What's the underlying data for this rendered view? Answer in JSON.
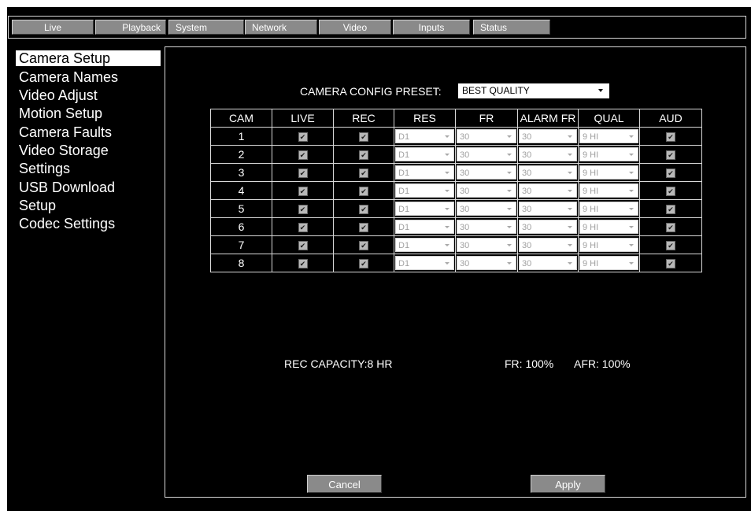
{
  "nav": {
    "tabs": [
      "Live",
      "Playback",
      "System",
      "Network",
      "Video",
      "Inputs",
      "Status"
    ]
  },
  "sidebar": {
    "items": [
      {
        "label": "Camera Setup",
        "active": true
      },
      {
        "label": "Camera Names"
      },
      {
        "label": "Video Adjust"
      },
      {
        "label": "Motion Setup"
      },
      {
        "label": "Camera Faults"
      },
      {
        "label": "Video Storage"
      },
      {
        "label": "Settings"
      },
      {
        "label": "USB Download"
      },
      {
        "label": "Setup"
      },
      {
        "label": "Codec Settings"
      }
    ]
  },
  "preset": {
    "label": "CAMERA CONFIG PRESET:",
    "value": "BEST QUALITY"
  },
  "table": {
    "headers": [
      "CAM",
      "LIVE",
      "REC",
      "RES",
      "FR",
      "ALARM FR",
      "QUAL",
      "AUD"
    ],
    "rows": [
      {
        "cam": "1",
        "live": true,
        "rec": true,
        "res": "D1",
        "fr": "30",
        "alarm_fr": "30",
        "qual": "9 HI",
        "aud": true
      },
      {
        "cam": "2",
        "live": true,
        "rec": true,
        "res": "D1",
        "fr": "30",
        "alarm_fr": "30",
        "qual": "9 HI",
        "aud": true
      },
      {
        "cam": "3",
        "live": true,
        "rec": true,
        "res": "D1",
        "fr": "30",
        "alarm_fr": "30",
        "qual": "9 HI",
        "aud": true
      },
      {
        "cam": "4",
        "live": true,
        "rec": true,
        "res": "D1",
        "fr": "30",
        "alarm_fr": "30",
        "qual": "9 HI",
        "aud": true
      },
      {
        "cam": "5",
        "live": true,
        "rec": true,
        "res": "D1",
        "fr": "30",
        "alarm_fr": "30",
        "qual": "9 HI",
        "aud": true
      },
      {
        "cam": "6",
        "live": true,
        "rec": true,
        "res": "D1",
        "fr": "30",
        "alarm_fr": "30",
        "qual": "9 HI",
        "aud": true
      },
      {
        "cam": "7",
        "live": true,
        "rec": true,
        "res": "D1",
        "fr": "30",
        "alarm_fr": "30",
        "qual": "9 HI",
        "aud": true
      },
      {
        "cam": "8",
        "live": true,
        "rec": true,
        "res": "D1",
        "fr": "30",
        "alarm_fr": "30",
        "qual": "9 HI",
        "aud": true
      }
    ]
  },
  "status": {
    "rec_capacity": "REC CAPACITY:8 HR",
    "fr": "FR: 100%",
    "afr": "AFR: 100%"
  },
  "buttons": {
    "cancel": "Cancel",
    "apply": "Apply"
  },
  "icons": {
    "checkbox": "checkbox-checked-icon",
    "dropdown": "chevron-down-icon"
  },
  "colors": {
    "background": "#000000",
    "tab": "#8a8a8a",
    "active_item": "#ffffff",
    "border": "#d8d8d8"
  }
}
